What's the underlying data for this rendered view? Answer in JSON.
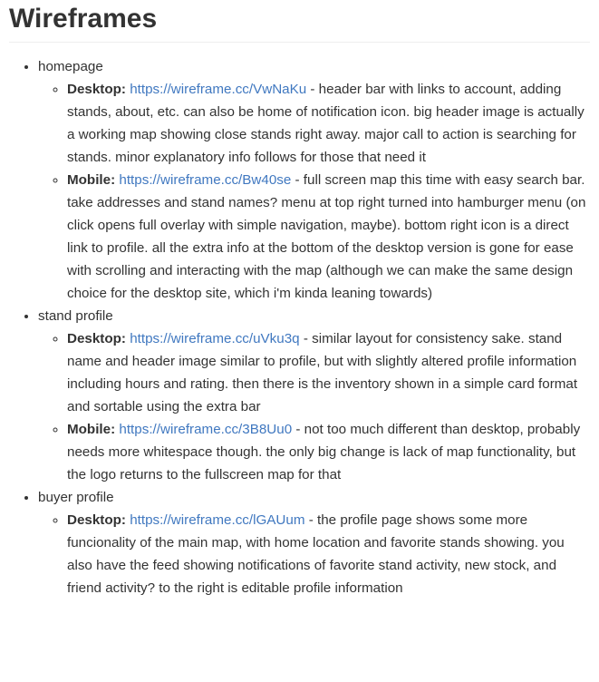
{
  "title": "Wireframes",
  "sections": [
    {
      "name": "homepage",
      "items": [
        {
          "label": "Desktop:",
          "url": "https://wireframe.cc/VwNaKu",
          "text": " - header bar with links to account, adding stands, about, etc. can also be home of notification icon. big header image is actually a working map showing close stands right away. major call to action is searching for stands. minor explanatory info follows for those that need it"
        },
        {
          "label": "Mobile:",
          "url": "https://wireframe.cc/Bw40se",
          "text": " - full screen map this time with easy search bar. take addresses and stand names? menu at top right turned into hamburger menu (on click opens full overlay with simple navigation, maybe). bottom right icon is a direct link to profile. all the extra info at the bottom of the desktop version is gone for ease with scrolling and interacting with the map (although we can make the same design choice for the desktop site, which i'm kinda leaning towards)"
        }
      ]
    },
    {
      "name": "stand profile",
      "items": [
        {
          "label": "Desktop:",
          "url": "https://wireframe.cc/uVku3q",
          "text": " - similar layout for consistency sake. stand name and header image similar to profile, but with slightly altered profile information including hours and rating. then there is the inventory shown in a simple card format and sortable using the extra bar"
        },
        {
          "label": "Mobile:",
          "url": "https://wireframe.cc/3B8Uu0",
          "text": " - not too much different than desktop, probably needs more whitespace though. the only big change is lack of map functionality, but the logo returns to the fullscreen map for that"
        }
      ]
    },
    {
      "name": "buyer profile",
      "items": [
        {
          "label": "Desktop:",
          "url": "https://wireframe.cc/lGAUum",
          "text": " - the profile page shows some more funcionality of the main map, with home location and favorite stands showing. you also have the feed showing notifications of favorite stand activity, new stock, and friend activity? to the right is editable profile information"
        }
      ]
    }
  ]
}
